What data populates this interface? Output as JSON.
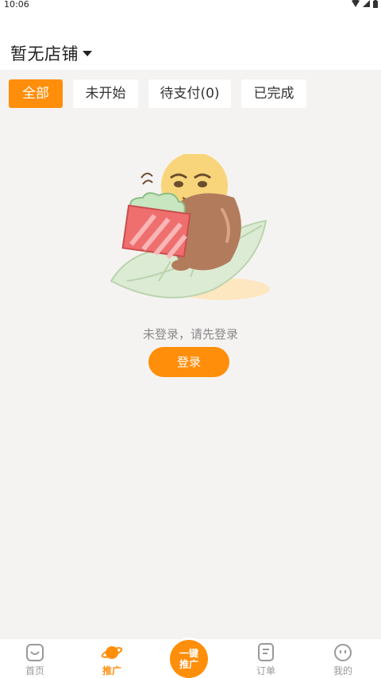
{
  "status_bar": {
    "time": "10:06"
  },
  "header": {
    "store_name": "暂无店铺"
  },
  "filter_tabs": [
    {
      "label": "全部",
      "active": true
    },
    {
      "label": "未开始",
      "active": false
    },
    {
      "label": "待支付(0)",
      "active": false
    },
    {
      "label": "已完成",
      "active": false
    }
  ],
  "empty_state": {
    "message": "未登录，请先登录",
    "login_button": "登录"
  },
  "bottom_nav": {
    "items": [
      {
        "label": "首页",
        "icon": "home-icon"
      },
      {
        "label": "推广",
        "icon": "planet-icon",
        "active": true
      },
      {
        "label": "订单",
        "icon": "order-icon"
      },
      {
        "label": "我的",
        "icon": "profile-icon"
      }
    ],
    "center_button": {
      "line1": "一键",
      "line2": "推广"
    }
  },
  "colors": {
    "accent": "#ff8e0a",
    "background": "#f5f3f2"
  }
}
